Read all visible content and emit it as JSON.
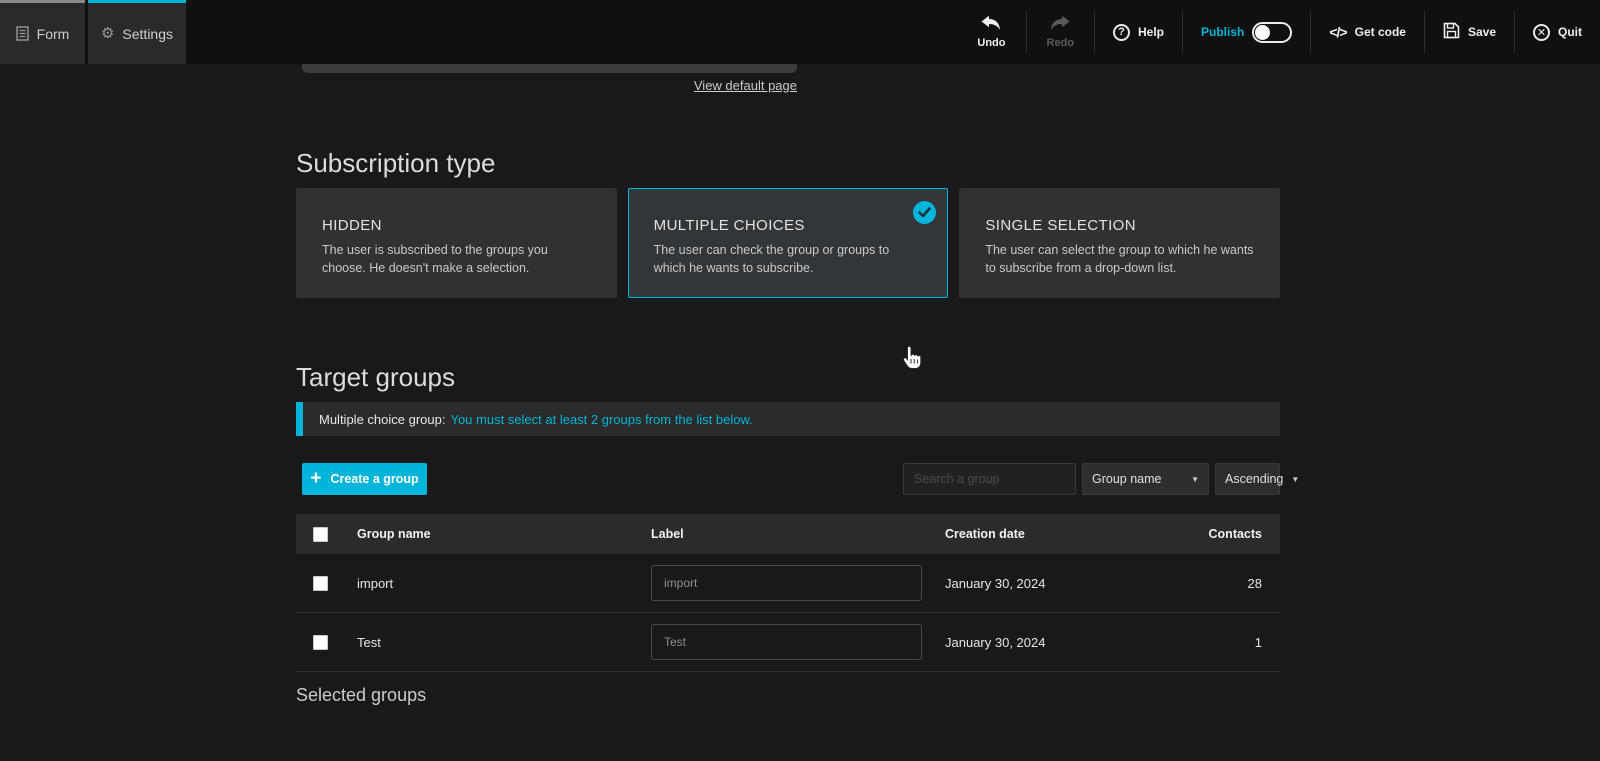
{
  "accent_color": "#00b5d9",
  "topbar": {
    "tabs": [
      {
        "label": "Form"
      },
      {
        "label": "Settings"
      }
    ],
    "actions": {
      "undo": "Undo",
      "redo": "Redo",
      "help": "Help",
      "publish": "Publish",
      "get_code": "Get code",
      "save": "Save",
      "quit": "Quit",
      "code_glyph": "</>"
    }
  },
  "page": {
    "view_default_link": "View default page",
    "subscription": {
      "title": "Subscription type",
      "options": [
        {
          "name": "HIDDEN",
          "description": "The user is subscribed to the groups you choose. He doesn't make a selection.",
          "selected": false
        },
        {
          "name": "MULTIPLE CHOICES",
          "description": "The user can check the group or groups to which he wants to subscribe.",
          "selected": true
        },
        {
          "name": "SINGLE SELECTION",
          "description": "The user can select the group to which he wants to subscribe from a drop-down list.",
          "selected": false
        }
      ]
    },
    "target_groups": {
      "title": "Target groups",
      "notice_label": "Multiple choice group:",
      "notice_text": "You must select at least 2 groups from the list below.",
      "create_button": "Create a group",
      "search_placeholder": "Search a group",
      "sort_field": "Group name",
      "sort_order": "Ascending",
      "table": {
        "headers": [
          "Group name",
          "Label",
          "Creation date",
          "Contacts"
        ],
        "rows": [
          {
            "group_name": "import",
            "label_value": "import",
            "creation_date": "January 30, 2024",
            "contacts": "28"
          },
          {
            "group_name": "Test",
            "label_value": "Test",
            "creation_date": "January 30, 2024",
            "contacts": "1"
          }
        ]
      }
    },
    "selected_groups_title": "Selected groups"
  }
}
